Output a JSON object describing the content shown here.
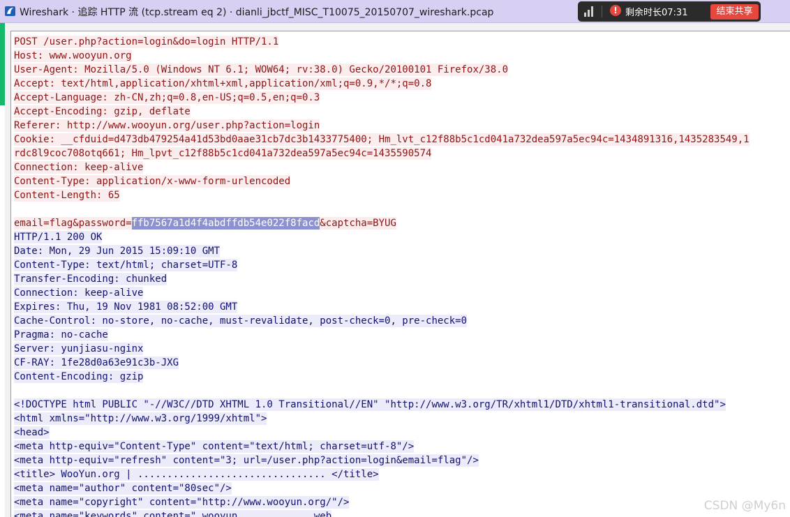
{
  "window": {
    "title": "Wireshark · 追踪 HTTP 流 (tcp.stream eq 2) · dianli_jbctf_MISC_T10075_20150707_wireshark.pcap",
    "icon": "wireshark-fin-icon",
    "accent_color": "#d7d0f2"
  },
  "share_bar": {
    "signal_icon": "signal-bars-icon",
    "warning_icon": "warning-circle-icon",
    "warning_glyph": "!",
    "remaining_time": "剩余时长07:31",
    "end_share_label": "结束共享",
    "button_color": "#e5483e"
  },
  "stream": {
    "client_color": "#8c1515",
    "client_bg": "#fbeded",
    "server_color": "#12126e",
    "server_bg": "#ebebfa",
    "selection_bg": "#8e91cf",
    "request_lines": [
      "POST /user.php?action=login&do=login HTTP/1.1",
      "Host: www.wooyun.org",
      "User-Agent: Mozilla/5.0 (Windows NT 6.1; WOW64; rv:38.0) Gecko/20100101 Firefox/38.0",
      "Accept: text/html,application/xhtml+xml,application/xml;q=0.9,*/*;q=0.8",
      "Accept-Language: zh-CN,zh;q=0.8,en-US;q=0.5,en;q=0.3",
      "Accept-Encoding: gzip, deflate",
      "Referer: http://www.wooyun.org/user.php?action=login",
      "Cookie: __cfduid=d473db479254a41d53bd0aae31cb7dc3b1433775400; Hm_lvt_c12f88b5c1cd041a732dea597a5ec94c=1434891316,1435283549,1",
      "rdc8l9coc708otq661; Hm_lpvt_c12f88b5c1cd041a732dea597a5ec94c=1435590574",
      "Connection: keep-alive",
      "Content-Type: application/x-www-form-urlencoded",
      "Content-Length: 65"
    ],
    "body_prefix": "email=flag&password=",
    "body_selected": "ffb7567a1d4f4abdffdb54e022f8facd",
    "body_suffix": "&captcha=BYUG",
    "response_lines": [
      "HTTP/1.1 200 OK",
      "Date: Mon, 29 Jun 2015 15:09:10 GMT",
      "Content-Type: text/html; charset=UTF-8",
      "Transfer-Encoding: chunked",
      "Connection: keep-alive",
      "Expires: Thu, 19 Nov 1981 08:52:00 GMT",
      "Cache-Control: no-store, no-cache, must-revalidate, post-check=0, pre-check=0",
      "Pragma: no-cache",
      "Server: yunjiasu-nginx",
      "CF-RAY: 1fe28d0a63e91c3b-JXG",
      "Content-Encoding: gzip"
    ],
    "html_lines": [
      "<!DOCTYPE html PUBLIC \"-//W3C//DTD XHTML 1.0 Transitional//EN\" \"http://www.w3.org/TR/xhtml1/DTD/xhtml1-transitional.dtd\">",
      "<html xmlns=\"http://www.w3.org/1999/xhtml\">",
      "<head>",
      "<meta http-equiv=\"Content-Type\" content=\"text/html; charset=utf-8\"/>",
      "<meta http-equiv=\"refresh\" content=\"3; url=/user.php?action=login&email=flag\"/>",
      "<title> WooYun.org | ................................ </title>",
      "<meta name=\"author\" content=\"80sec\"/>",
      "<meta name=\"copyright\" content=\"http://www.wooyun.org/\"/>",
      "<meta name=\"keywords\" content=\",wooyun,           ,web"
    ]
  },
  "watermark": "CSDN @My6n"
}
